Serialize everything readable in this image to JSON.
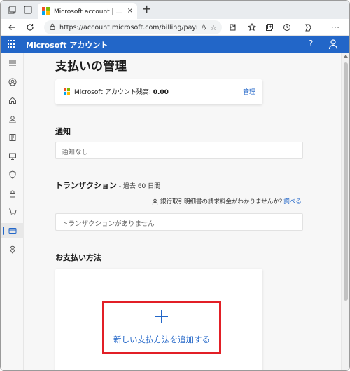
{
  "browser": {
    "tab_title": "Microsoft account | 支払いオプション",
    "tab_close": "×",
    "new_tab": "+",
    "url": "https://account.microsoft.com/billing/payment...",
    "read_aloud": "Aͅ"
  },
  "header": {
    "brand": "Microsoft アカウント",
    "help": "?"
  },
  "page": {
    "title": "支払いの管理",
    "balance_label": "Microsoft アカウント残高: ",
    "balance_value": "0.00",
    "manage_link": "管理",
    "notifications_heading": "通知",
    "notifications_empty": "通知なし",
    "transactions_heading": "トランザクション",
    "transactions_period": " - 過去 60 日間",
    "bank_question": "銀行取引明細書の請求料金がわかりませんか?",
    "bank_link": "調べる",
    "transactions_empty": "トランザクションがありません",
    "payment_methods_heading": "お支払い方法",
    "add_payment_method": "新しい支払方法を追加する"
  },
  "colors": {
    "accent": "#2266c8",
    "highlight_box": "#e21f26"
  },
  "icons": [
    "tab-actions-icon",
    "vertical-tabs-icon",
    "back-icon",
    "refresh-icon",
    "lock-icon",
    "favorite-icon",
    "extensions-icon",
    "favorites-bar-icon",
    "collections-icon",
    "history-icon",
    "copilot-icon",
    "waffle-icon",
    "profile-icon",
    "menu-icon",
    "home-icon",
    "person-icon",
    "rewards-icon",
    "devices-icon",
    "security-icon",
    "privacy-icon",
    "orders-icon",
    "payment-icon",
    "location-icon"
  ]
}
